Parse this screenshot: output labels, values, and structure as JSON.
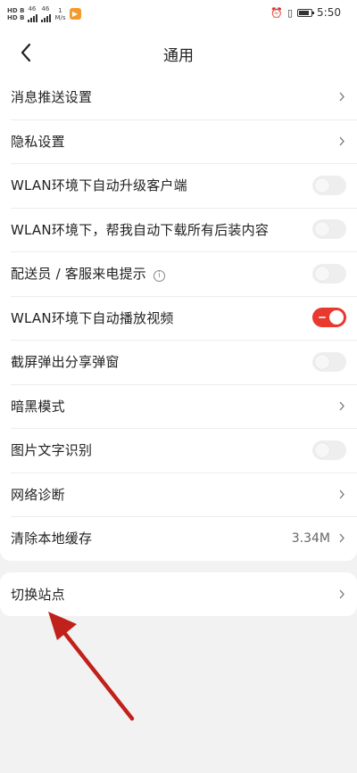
{
  "status_bar": {
    "hd_top": "HD B",
    "hd_bottom": "HD B",
    "signal_top": "46",
    "signal_bottom": "46",
    "net_speed_value": "1",
    "net_speed_unit": "M/s",
    "time": "5:50"
  },
  "header": {
    "title": "通用"
  },
  "settings": {
    "items": [
      {
        "label": "消息推送设置"
      },
      {
        "label": "隐私设置"
      },
      {
        "label": "WLAN环境下自动升级客户端"
      },
      {
        "label": "WLAN环境下，帮我自动下载所有后装内容"
      },
      {
        "label": "配送员 / 客服来电提示"
      },
      {
        "label": "WLAN环境下自动播放视频"
      },
      {
        "label": "截屏弹出分享弹窗"
      },
      {
        "label": "暗黑模式"
      },
      {
        "label": "图片文字识别"
      },
      {
        "label": "网络诊断"
      },
      {
        "label": "清除本地缓存",
        "value": "3.34M"
      }
    ],
    "toggle_states": {
      "auto_upgrade": false,
      "auto_download": false,
      "call_notice": false,
      "auto_play_video": true,
      "screenshot_share": false,
      "image_text_recognition": false
    }
  },
  "site": {
    "switch_label": "切换站点"
  },
  "colors": {
    "accent": "#e9382e",
    "background": "#f2f2f2",
    "arrow": "#c0211b"
  }
}
